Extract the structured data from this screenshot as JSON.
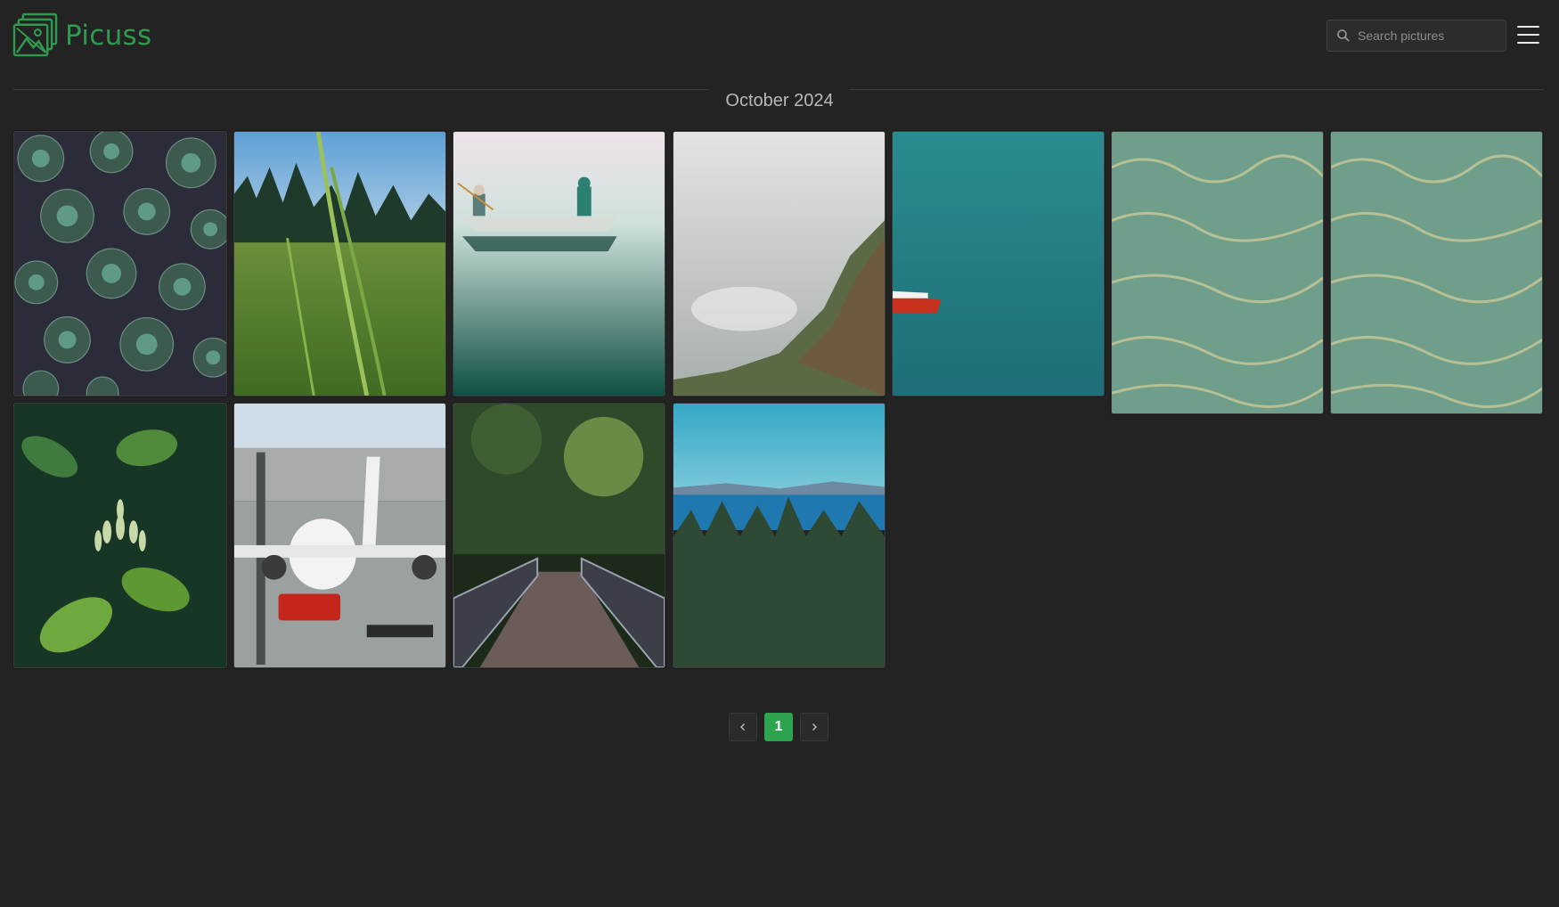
{
  "header": {
    "app_name": "Picuss",
    "search_placeholder": "Search pictures"
  },
  "gallery": {
    "section_title": "October 2024",
    "photos": [
      "succulents",
      "grass-meadow",
      "canoe-lake",
      "foggy-cliff",
      "red-boat-water",
      "clear-water-1",
      "clear-water-2",
      "green-leaves",
      "airplane",
      "forest-bridge",
      "forest-lake-view"
    ]
  },
  "pagination": {
    "prev_icon": "chevron-left",
    "current_page": "1",
    "next_icon": "chevron-right"
  },
  "colors": {
    "background": "#232323",
    "brand": "#2f9a4e",
    "active_page": "#2ea44f"
  }
}
